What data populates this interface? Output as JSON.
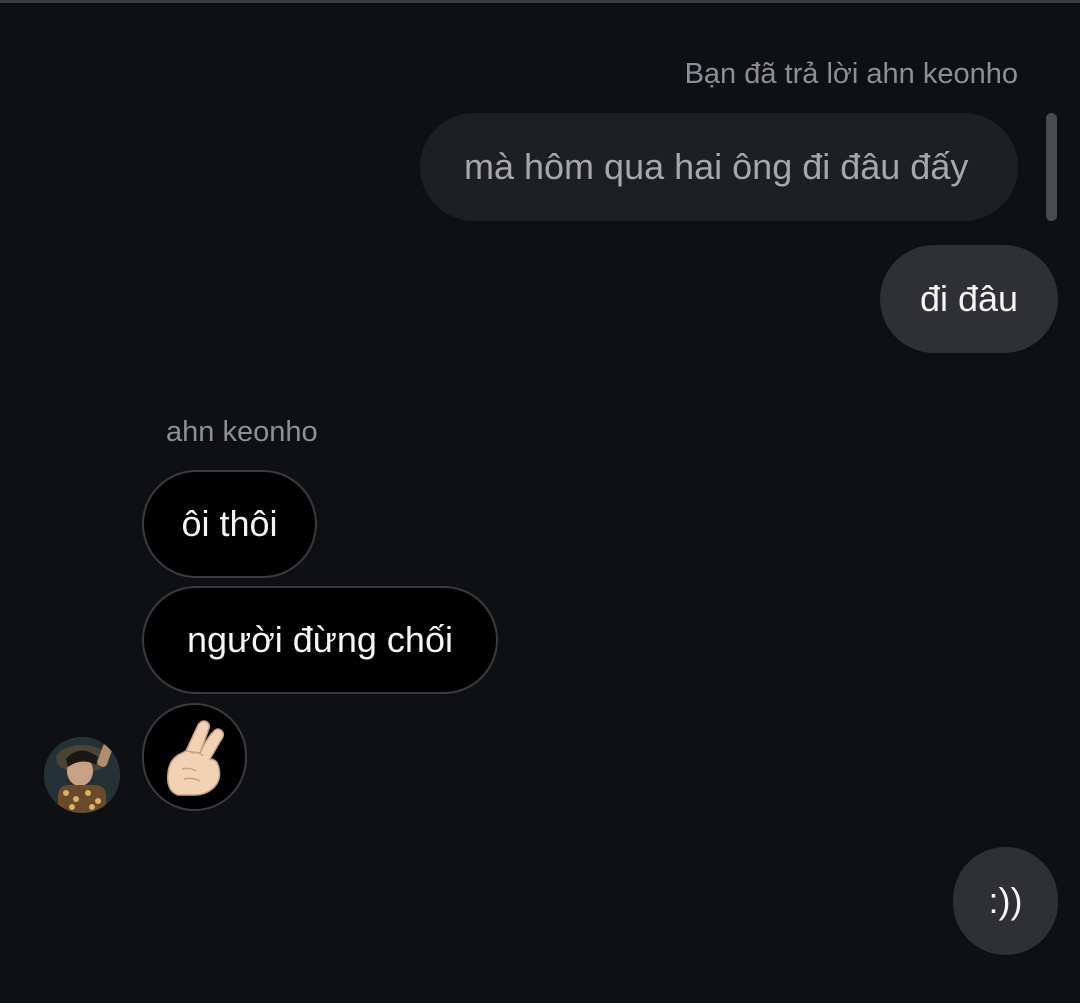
{
  "conversation": {
    "reply_caption": "Bạn đã trả lời ahn keonho",
    "quoted_message": "mà hôm qua hai ông đi đâu đấy",
    "sent_message_1": "đi đâu",
    "sender_name": "ahn keonho",
    "received_messages": [
      "ôi thôi",
      "người đừng chối"
    ],
    "received_emoji_icon": "finger-heart-hand-emoji",
    "sent_message_2": ":))"
  },
  "colors": {
    "background": "#0f1014",
    "sent_bubble": "#2f3034",
    "quoted_bubble": "#1e1f23",
    "received_bubble": "#000000",
    "received_border": "#3a3b40",
    "caption_text": "#8e8f96"
  }
}
